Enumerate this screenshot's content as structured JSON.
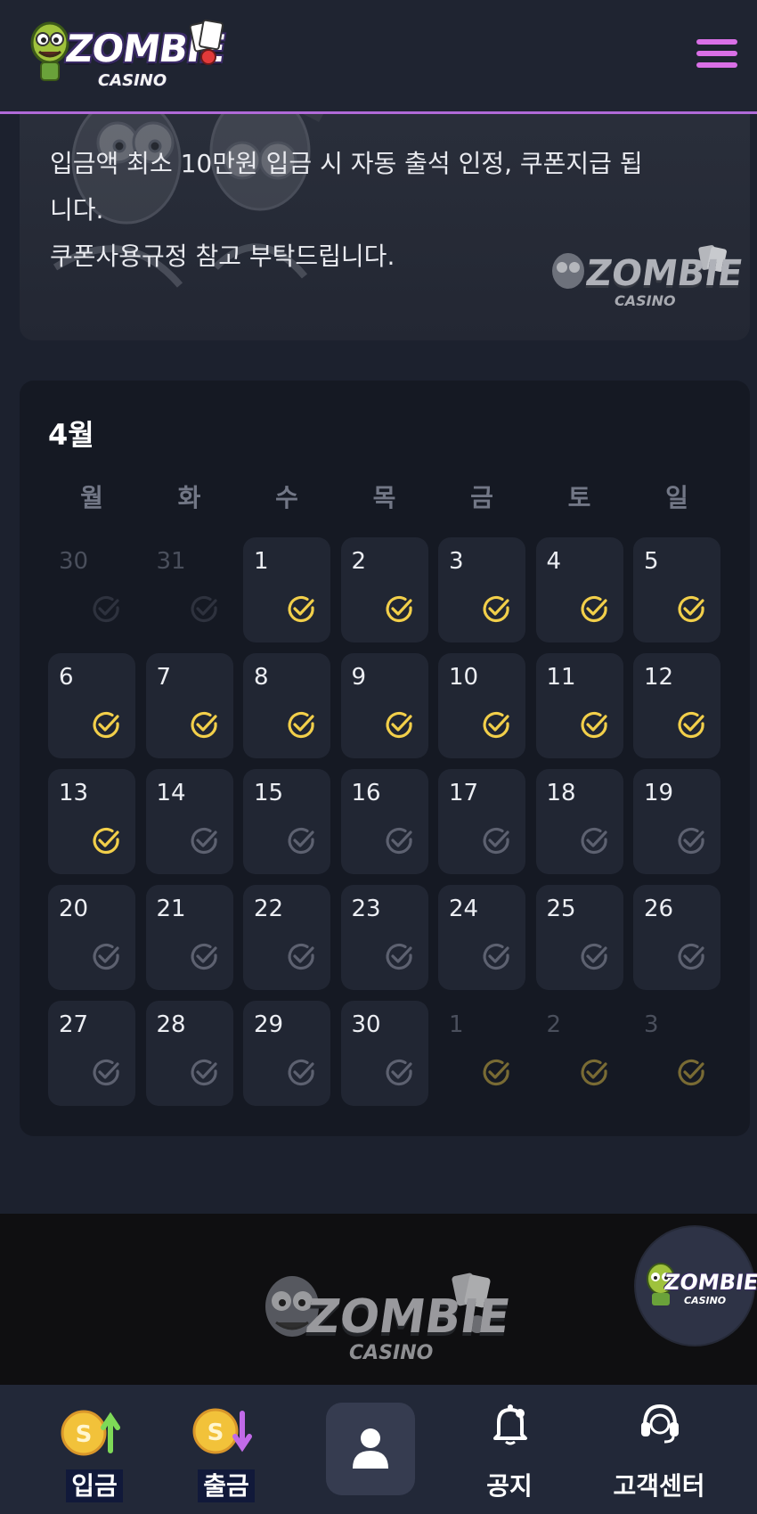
{
  "header": {
    "logo_main": "ZOMBIE",
    "logo_sub": "CASINO",
    "menu_icon": "hamburger-menu-icon",
    "accent_color": "#d96fe6"
  },
  "info": {
    "line1": "입금액 최소 10만원 입금 시 자동 출석 인정, 쿠폰지급 됩",
    "line2": "니다.",
    "line3": "쿠폰사용규정 참고 부탁드립니다.",
    "logo_main": "ZOMBIE",
    "logo_sub": "CASINO"
  },
  "calendar": {
    "month": "4월",
    "weekdays": [
      "월",
      "화",
      "수",
      "목",
      "금",
      "토",
      "일"
    ],
    "checked_color": "#f2cf4a",
    "unchecked_color": "#5d6170",
    "weeks": [
      [
        {
          "day": "30",
          "outside": true,
          "checked": false
        },
        {
          "day": "31",
          "outside": true,
          "checked": false
        },
        {
          "day": "1",
          "outside": false,
          "checked": true
        },
        {
          "day": "2",
          "outside": false,
          "checked": true
        },
        {
          "day": "3",
          "outside": false,
          "checked": true
        },
        {
          "day": "4",
          "outside": false,
          "checked": true
        },
        {
          "day": "5",
          "outside": false,
          "checked": true
        }
      ],
      [
        {
          "day": "6",
          "outside": false,
          "checked": true
        },
        {
          "day": "7",
          "outside": false,
          "checked": true
        },
        {
          "day": "8",
          "outside": false,
          "checked": true
        },
        {
          "day": "9",
          "outside": false,
          "checked": true
        },
        {
          "day": "10",
          "outside": false,
          "checked": true
        },
        {
          "day": "11",
          "outside": false,
          "checked": true
        },
        {
          "day": "12",
          "outside": false,
          "checked": true
        }
      ],
      [
        {
          "day": "13",
          "outside": false,
          "checked": true
        },
        {
          "day": "14",
          "outside": false,
          "checked": false
        },
        {
          "day": "15",
          "outside": false,
          "checked": false
        },
        {
          "day": "16",
          "outside": false,
          "checked": false
        },
        {
          "day": "17",
          "outside": false,
          "checked": false
        },
        {
          "day": "18",
          "outside": false,
          "checked": false
        },
        {
          "day": "19",
          "outside": false,
          "checked": false
        }
      ],
      [
        {
          "day": "20",
          "outside": false,
          "checked": false
        },
        {
          "day": "21",
          "outside": false,
          "checked": false
        },
        {
          "day": "22",
          "outside": false,
          "checked": false
        },
        {
          "day": "23",
          "outside": false,
          "checked": false
        },
        {
          "day": "24",
          "outside": false,
          "checked": false
        },
        {
          "day": "25",
          "outside": false,
          "checked": false
        },
        {
          "day": "26",
          "outside": false,
          "checked": false
        }
      ],
      [
        {
          "day": "27",
          "outside": false,
          "checked": false
        },
        {
          "day": "28",
          "outside": false,
          "checked": false
        },
        {
          "day": "29",
          "outside": false,
          "checked": false
        },
        {
          "day": "30",
          "outside": false,
          "checked": false
        },
        {
          "day": "1",
          "outside": true,
          "checked": true
        },
        {
          "day": "2",
          "outside": true,
          "checked": true
        },
        {
          "day": "3",
          "outside": true,
          "checked": true
        }
      ]
    ]
  },
  "footer": {
    "logo_main": "ZOMBIE",
    "logo_sub": "CASINO",
    "float_logo_main": "ZOMBIE",
    "float_logo_sub": "CASINO"
  },
  "bottom_nav": {
    "deposit": {
      "label": "입금",
      "icon": "coin-deposit-icon"
    },
    "withdraw": {
      "label": "출금",
      "icon": "coin-withdraw-icon"
    },
    "profile": {
      "icon": "user-icon"
    },
    "notice": {
      "label": "공지",
      "icon": "bell-icon"
    },
    "support": {
      "label": "고객센터",
      "icon": "headset-icon"
    }
  }
}
